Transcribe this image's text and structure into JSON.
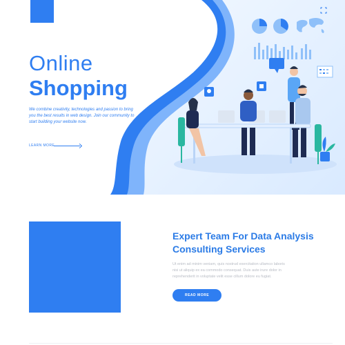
{
  "hero": {
    "title_line1": "Online",
    "title_line2": "Shopping",
    "description": "We combine creativity, technologies and passion to bring you the best results in web design. Join our community to start building your website now.",
    "cta_label": "LEARN MORE"
  },
  "feature": {
    "title": "Expert Team For Data Analysis Consulting Services",
    "text": "Ut enim ad minim veniam, quis nostrud exercitation ullamco laboris nisi ut aliquip ex ea commodo consequat. Duis aute irure dolor in reprehenderit in voluptate velit esse cillum dolore eu fugiat.",
    "button_label": "READ MORE"
  },
  "colors": {
    "accent": "#2f7ef1",
    "title_blue": "#2b7be6",
    "hero_light": "#e8f2ff",
    "body_text": "#b8bcc4"
  },
  "icons": [
    "expand-icon",
    "arrow-right-icon",
    "pie-chart-icon",
    "world-map-icon",
    "bar-chart-icon",
    "lightbulb-icon",
    "puzzle-icon",
    "calendar-icon",
    "chat-bubble-icon",
    "plant-icon"
  ]
}
